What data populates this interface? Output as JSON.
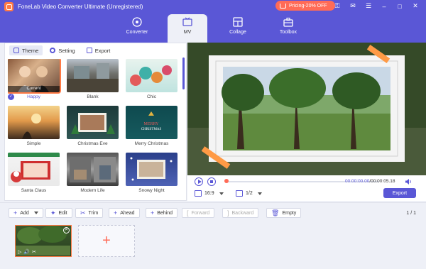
{
  "app": {
    "title": "FoneLab Video Converter Ultimate (Unregistered)",
    "promo_label": "Pricing-20% OFF"
  },
  "nav": {
    "tabs": [
      {
        "label": "Converter",
        "icon": "converter-icon"
      },
      {
        "label": "MV",
        "icon": "mv-icon",
        "active": true
      },
      {
        "label": "Collage",
        "icon": "collage-icon"
      },
      {
        "label": "Toolbox",
        "icon": "toolbox-icon"
      }
    ]
  },
  "subtabs": {
    "theme": "Theme",
    "setting": "Setting",
    "export": "Export"
  },
  "themes": [
    {
      "label": "Happy",
      "selected": true,
      "badge": "Current"
    },
    {
      "label": "Blank"
    },
    {
      "label": "Chic"
    },
    {
      "label": "Simple"
    },
    {
      "label": "Christmas Eve"
    },
    {
      "label": "Merry Christmas"
    },
    {
      "label": "Santa Claus"
    },
    {
      "label": "Modern Life"
    },
    {
      "label": "Snowy Night"
    }
  ],
  "player": {
    "current_time": "00:00:00.00",
    "total_time": "/00:00:05.18",
    "progress": 0,
    "aspect_ratio": "16:9",
    "split": "1/2",
    "export_label": "Export"
  },
  "toolbar": {
    "add": "Add",
    "edit": "Edit",
    "trim": "Trim",
    "ahead": "Ahead",
    "behind": "Behind",
    "forward": "Forward",
    "backward": "Backward",
    "empty": "Empty",
    "page_indicator": "1 / 1"
  },
  "colors": {
    "accent": "#5a57d6",
    "highlight": "#ff7a45",
    "promo": "#ff6b57"
  }
}
